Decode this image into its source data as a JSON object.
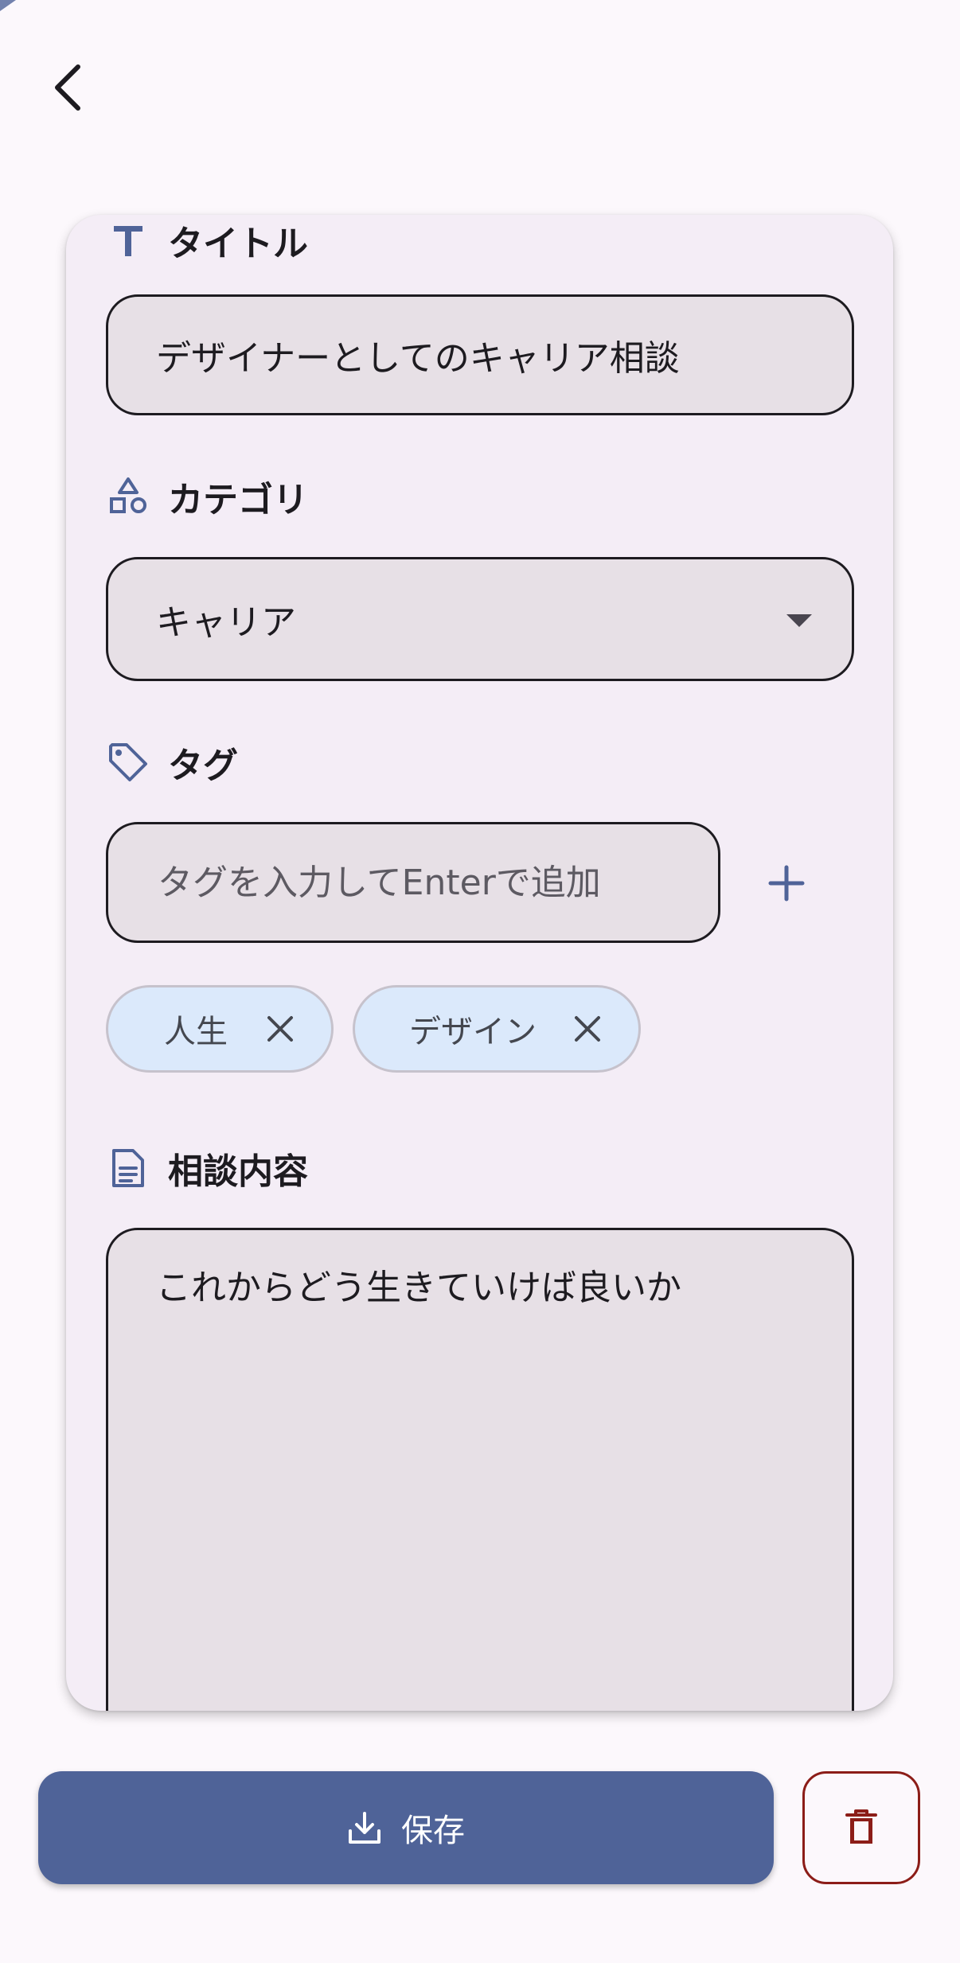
{
  "header": {
    "back_icon": "chevron-left-icon"
  },
  "form": {
    "title": {
      "label": "タイトル",
      "icon": "text-t-icon",
      "value": "デザイナーとしてのキャリア相談"
    },
    "category": {
      "label": "カテゴリ",
      "icon": "shapes-icon",
      "selected": "キャリア"
    },
    "tags": {
      "label": "タグ",
      "icon": "tag-icon",
      "input_placeholder": "タグを入力してEnterで追加",
      "add_icon": "plus-icon",
      "items": [
        {
          "label": "人生"
        },
        {
          "label": "デザイン"
        }
      ]
    },
    "content": {
      "label": "相談内容",
      "icon": "document-icon",
      "value": "これからどう生きていけば良いか"
    }
  },
  "actions": {
    "save_label": "保存",
    "save_icon": "download-icon",
    "delete_icon": "trash-icon"
  },
  "colors": {
    "primary": "#4f6398",
    "card_bg": "#f4edf6",
    "field_bg": "#e7e0e6",
    "chip_bg": "#dbe9fb",
    "delete_red": "#8c1d18"
  }
}
